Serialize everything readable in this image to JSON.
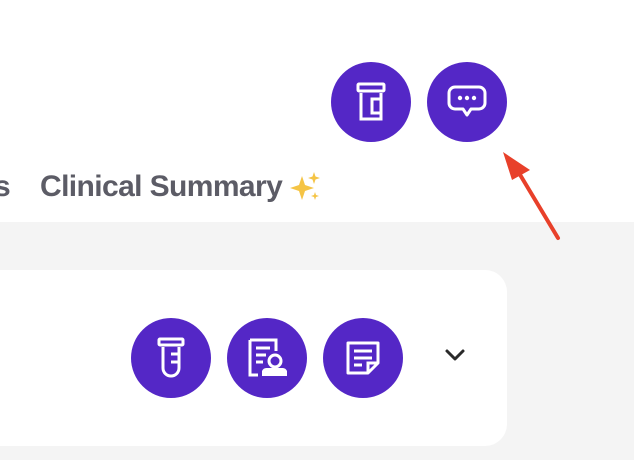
{
  "tabs": {
    "previous_partial": "s",
    "clinical_summary": "Clinical Summary",
    "sparkle": "sparkles-icon"
  },
  "header_buttons": [
    {
      "icon": "pill-bottle-icon"
    },
    {
      "icon": "chat-bubble-icon"
    }
  ],
  "card_buttons": [
    {
      "icon": "test-tube-icon"
    },
    {
      "icon": "patient-record-icon"
    },
    {
      "icon": "note-icon"
    }
  ],
  "card_toggle": {
    "icon": "chevron-down-icon"
  },
  "colors": {
    "accent": "#5427c6",
    "tab_text": "#5c5c66",
    "content_bg": "#f4f4f4",
    "annotation_arrow": "#e8402a"
  }
}
